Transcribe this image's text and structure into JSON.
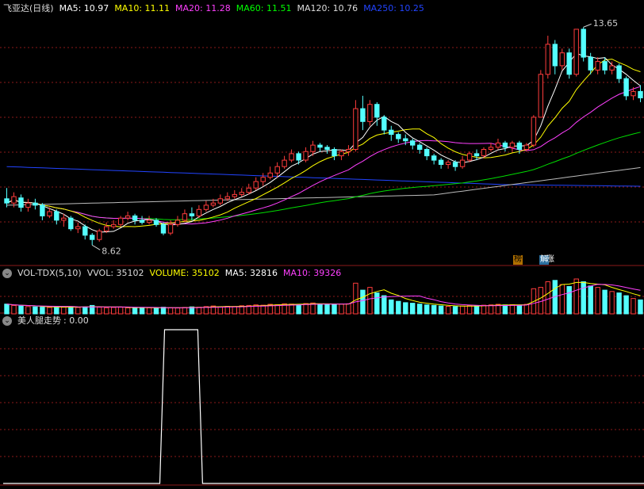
{
  "main": {
    "title": "飞亚达(日线)",
    "indicators": [
      {
        "label": "MA5: 10.97",
        "color": "#ffffff"
      },
      {
        "label": "MA10: 11.11",
        "color": "#ffff00"
      },
      {
        "label": "MA20: 11.28",
        "color": "#ff40ff"
      },
      {
        "label": "MA60: 11.51",
        "color": "#00ff00"
      },
      {
        "label": "MA120: 10.76",
        "color": "#dddddd"
      },
      {
        "label": "MA250: 10.25",
        "color": "#2244ff"
      }
    ],
    "high_label": "13.65",
    "low_label": "8.62",
    "badges": [
      "榜",
      "解",
      "涨"
    ]
  },
  "volume": {
    "title": "VOL-TDX(5,10)",
    "indicators": [
      {
        "label": "VVOL: 35102",
        "color": "#dddddd"
      },
      {
        "label": "VOLUME: 35102",
        "color": "#ffff00"
      },
      {
        "label": "MA5: 32816",
        "color": "#ffffff"
      },
      {
        "label": "MA10: 39326",
        "color": "#ff40ff"
      }
    ]
  },
  "indicator": {
    "title": "美人腿走势",
    "value": ": 0.00"
  },
  "colors": {
    "up": "#ff3c3c",
    "down": "#54ffff",
    "grid": "#8b1a1a",
    "ma250": "#2244ff"
  },
  "chart_data": {
    "type": "candlestick",
    "price_range": [
      8.2,
      14.0
    ],
    "candles": [
      [
        9.7,
        9.6,
        9.95,
        9.5
      ],
      [
        9.6,
        9.75,
        9.85,
        9.5
      ],
      [
        9.72,
        9.5,
        9.8,
        9.4
      ],
      [
        9.5,
        9.6,
        9.7,
        9.4
      ],
      [
        9.6,
        9.55,
        9.7,
        9.45
      ],
      [
        9.55,
        9.3,
        9.6,
        9.2
      ],
      [
        9.3,
        9.4,
        9.5,
        9.25
      ],
      [
        9.4,
        9.2,
        9.45,
        9.1
      ],
      [
        9.2,
        9.25,
        9.35,
        9.05
      ],
      [
        9.25,
        9.0,
        9.3,
        8.95
      ],
      [
        9.0,
        9.05,
        9.15,
        8.9
      ],
      [
        9.05,
        8.85,
        9.1,
        8.75
      ],
      [
        8.85,
        8.75,
        8.9,
        8.62
      ],
      [
        8.75,
        8.95,
        9.0,
        8.7
      ],
      [
        8.95,
        9.05,
        9.15,
        8.9
      ],
      [
        9.05,
        9.1,
        9.2,
        9.0
      ],
      [
        9.1,
        9.25,
        9.3,
        9.05
      ],
      [
        9.25,
        9.3,
        9.4,
        9.2
      ],
      [
        9.3,
        9.2,
        9.35,
        9.1
      ],
      [
        9.2,
        9.15,
        9.3,
        9.1
      ],
      [
        9.15,
        9.2,
        9.3,
        9.1
      ],
      [
        9.2,
        9.1,
        9.25,
        9.05
      ],
      [
        9.1,
        8.9,
        9.15,
        8.85
      ],
      [
        8.9,
        9.1,
        9.2,
        8.85
      ],
      [
        9.1,
        9.2,
        9.3,
        9.05
      ],
      [
        9.2,
        9.35,
        9.45,
        9.15
      ],
      [
        9.35,
        9.3,
        9.5,
        9.2
      ],
      [
        9.3,
        9.45,
        9.55,
        9.25
      ],
      [
        9.45,
        9.55,
        9.65,
        9.4
      ],
      [
        9.55,
        9.6,
        9.7,
        9.5
      ],
      [
        9.6,
        9.7,
        9.8,
        9.55
      ],
      [
        9.7,
        9.75,
        9.85,
        9.65
      ],
      [
        9.75,
        9.8,
        9.9,
        9.7
      ],
      [
        9.8,
        9.85,
        9.95,
        9.75
      ],
      [
        9.85,
        9.95,
        10.05,
        9.8
      ],
      [
        9.95,
        10.1,
        10.2,
        9.9
      ],
      [
        10.1,
        10.2,
        10.3,
        10.0
      ],
      [
        10.2,
        10.3,
        10.45,
        10.15
      ],
      [
        10.3,
        10.45,
        10.55,
        10.2
      ],
      [
        10.45,
        10.6,
        10.7,
        10.4
      ],
      [
        10.6,
        10.75,
        10.85,
        10.55
      ],
      [
        10.75,
        10.6,
        10.8,
        10.5
      ],
      [
        10.6,
        10.8,
        10.9,
        10.55
      ],
      [
        10.8,
        10.95,
        11.05,
        10.7
      ],
      [
        10.95,
        10.9,
        11.0,
        10.8
      ],
      [
        10.9,
        10.85,
        10.95,
        10.75
      ],
      [
        10.85,
        10.7,
        10.9,
        10.6
      ],
      [
        10.7,
        10.8,
        10.85,
        10.6
      ],
      [
        10.8,
        10.85,
        10.95,
        10.7
      ],
      [
        10.85,
        11.8,
        12.0,
        10.8
      ],
      [
        11.8,
        11.5,
        12.1,
        11.3
      ],
      [
        11.5,
        11.9,
        12.0,
        11.4
      ],
      [
        11.9,
        11.6,
        11.95,
        11.4
      ],
      [
        11.6,
        11.3,
        11.65,
        11.2
      ],
      [
        11.3,
        11.2,
        11.4,
        11.05
      ],
      [
        11.2,
        11.1,
        11.25,
        11.0
      ],
      [
        11.1,
        11.05,
        11.2,
        10.95
      ],
      [
        11.05,
        10.95,
        11.1,
        10.85
      ],
      [
        10.95,
        10.85,
        11.0,
        10.75
      ],
      [
        10.85,
        10.7,
        10.9,
        10.6
      ],
      [
        10.7,
        10.6,
        10.75,
        10.5
      ],
      [
        10.6,
        10.5,
        10.65,
        10.4
      ],
      [
        10.5,
        10.55,
        10.6,
        10.4
      ],
      [
        10.55,
        10.45,
        10.6,
        10.35
      ],
      [
        10.45,
        10.6,
        10.7,
        10.4
      ],
      [
        10.6,
        10.75,
        10.8,
        10.55
      ],
      [
        10.75,
        10.7,
        10.85,
        10.6
      ],
      [
        10.7,
        10.85,
        10.9,
        10.65
      ],
      [
        10.85,
        10.9,
        11.0,
        10.8
      ],
      [
        10.9,
        11.0,
        11.1,
        10.85
      ],
      [
        11.0,
        10.9,
        11.05,
        10.8
      ],
      [
        10.9,
        11.0,
        11.05,
        10.8
      ],
      [
        11.0,
        10.85,
        11.05,
        10.75
      ],
      [
        10.85,
        10.95,
        11.0,
        10.8
      ],
      [
        10.95,
        11.6,
        11.65,
        10.9
      ],
      [
        11.6,
        12.6,
        12.7,
        11.6
      ],
      [
        12.6,
        13.3,
        13.5,
        12.5
      ],
      [
        13.3,
        12.8,
        13.4,
        12.6
      ],
      [
        12.8,
        13.1,
        13.2,
        12.7
      ],
      [
        13.1,
        12.6,
        13.2,
        12.5
      ],
      [
        12.6,
        13.65,
        13.65,
        12.55
      ],
      [
        13.65,
        13.0,
        13.7,
        12.9
      ],
      [
        13.0,
        12.7,
        13.1,
        12.6
      ],
      [
        12.7,
        12.9,
        13.0,
        12.6
      ],
      [
        12.9,
        12.7,
        13.0,
        12.6
      ],
      [
        12.7,
        12.8,
        12.9,
        12.6
      ],
      [
        12.8,
        12.5,
        12.85,
        12.4
      ],
      [
        12.5,
        12.1,
        12.55,
        12.0
      ],
      [
        12.1,
        12.2,
        12.3,
        12.0
      ],
      [
        12.2,
        12.05,
        12.35,
        11.95
      ]
    ],
    "volumes": [
      3.5,
      3.0,
      2.8,
      2.6,
      2.5,
      2.4,
      2.3,
      2.5,
      2.4,
      2.6,
      2.3,
      2.5,
      3.0,
      2.4,
      2.2,
      2.3,
      2.4,
      2.2,
      2.1,
      2.3,
      2.2,
      2.0,
      2.4,
      2.2,
      2.1,
      2.3,
      2.5,
      2.4,
      2.6,
      2.8,
      2.5,
      2.7,
      2.6,
      2.9,
      3.0,
      3.2,
      3.1,
      3.4,
      3.3,
      3.6,
      3.5,
      3.4,
      3.7,
      3.9,
      3.5,
      3.4,
      3.3,
      3.5,
      3.6,
      11.0,
      8.5,
      9.5,
      7.5,
      6.5,
      5.0,
      4.5,
      4.0,
      3.8,
      3.5,
      3.2,
      3.0,
      2.8,
      2.7,
      2.6,
      2.8,
      3.0,
      2.9,
      3.1,
      3.2,
      3.4,
      3.2,
      3.3,
      3.1,
      3.4,
      9.0,
      9.5,
      11.5,
      12.0,
      10.5,
      9.8,
      12.5,
      11.5,
      10.0,
      9.5,
      8.5,
      8.0,
      7.5,
      6.5,
      5.5,
      5.0
    ],
    "signal_high": [
      22,
      27
    ]
  }
}
